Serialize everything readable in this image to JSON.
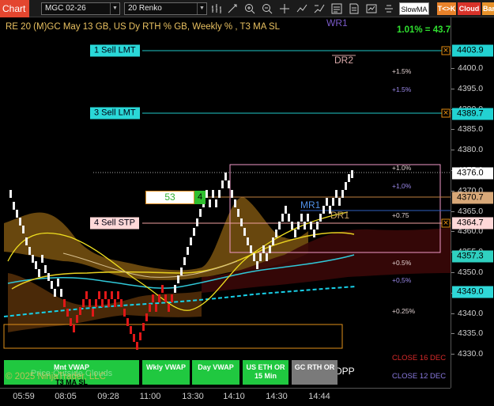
{
  "toolbar": {
    "tab_label": "Chart",
    "instrument": "MGC 02-26",
    "interval": "20 Renko",
    "indicator_name": "SlowMA",
    "tk_label": "T<>K",
    "cloud_label": "Cloud",
    "bar_label": "Bar",
    "colors": {
      "tab": "#e3462f",
      "tk_bg": "#e8822a",
      "cloud_bg": "#d8332a",
      "bar_bg": "#e8922a"
    }
  },
  "chart": {
    "title": "RE 20  (M)GC May 13 GB, US Dy RTH % GB, Weekly % , T3 MA SL",
    "change": "1.01% = 43.7",
    "copyright": "© 2025 NinjaTrader, LLC",
    "watermark": "Price Outside Clouds",
    "y_ticks": [
      "4400.0",
      "4395.0",
      "4390.0",
      "4385.0",
      "4380.0",
      "4375.0",
      "4370.0",
      "4365.0",
      "4360.0",
      "4355.0",
      "4350.0",
      "4345.0",
      "4340.0",
      "4335.0",
      "4330.0"
    ],
    "x_ticks": [
      "05:59",
      "08:05",
      "09:28",
      "11:00",
      "13:30",
      "14:10",
      "14:30",
      "14:44"
    ],
    "price_boxes": [
      {
        "value": "4403.9",
        "bg": "#22d2d2"
      },
      {
        "value": "4389.7",
        "bg": "#22d2d2"
      },
      {
        "value": "4376.0",
        "bg": "#ffffff"
      },
      {
        "value": "4370.7",
        "bg": "#d8a878"
      },
      {
        "value": "4364.7",
        "bg": "#ffd8d8"
      },
      {
        "value": "4357.3",
        "bg": "#2fd0c0"
      },
      {
        "value": "4349.0",
        "bg": "#2fd8d8"
      }
    ],
    "orders": [
      {
        "label": "1 Sell LMT",
        "type": "limit"
      },
      {
        "label": "3 Sell LMT",
        "type": "limit"
      },
      {
        "label": "4 Sell STP",
        "type": "stop"
      }
    ],
    "position": {
      "qty": "53",
      "count": "4"
    },
    "level_labels": {
      "wr1": "WR1",
      "dr2": "DR2",
      "mr1": "MR1",
      "dr1": "DR1",
      "dpp": "DPP"
    },
    "pct_labels": [
      "+1.5%",
      "+1.5%",
      "+1.0%",
      "+1,0%",
      "+0.75",
      "+0.5%",
      "+0,5%",
      "+0.25%"
    ],
    "close_labels": {
      "close16": "CLOSE 16 DEC",
      "close12": "CLOSE 12 DEC"
    },
    "buttons": {
      "mnt_vwap": "Mnt VWAP",
      "mnt_vwap_sub": "T3 MA SL",
      "wkly_vwap": "Wkly VWAP",
      "day_vwap": "Day VWAP",
      "us_eth": "US ETH OR 15 Min",
      "gc_rth": "GC RTH OR"
    }
  }
}
